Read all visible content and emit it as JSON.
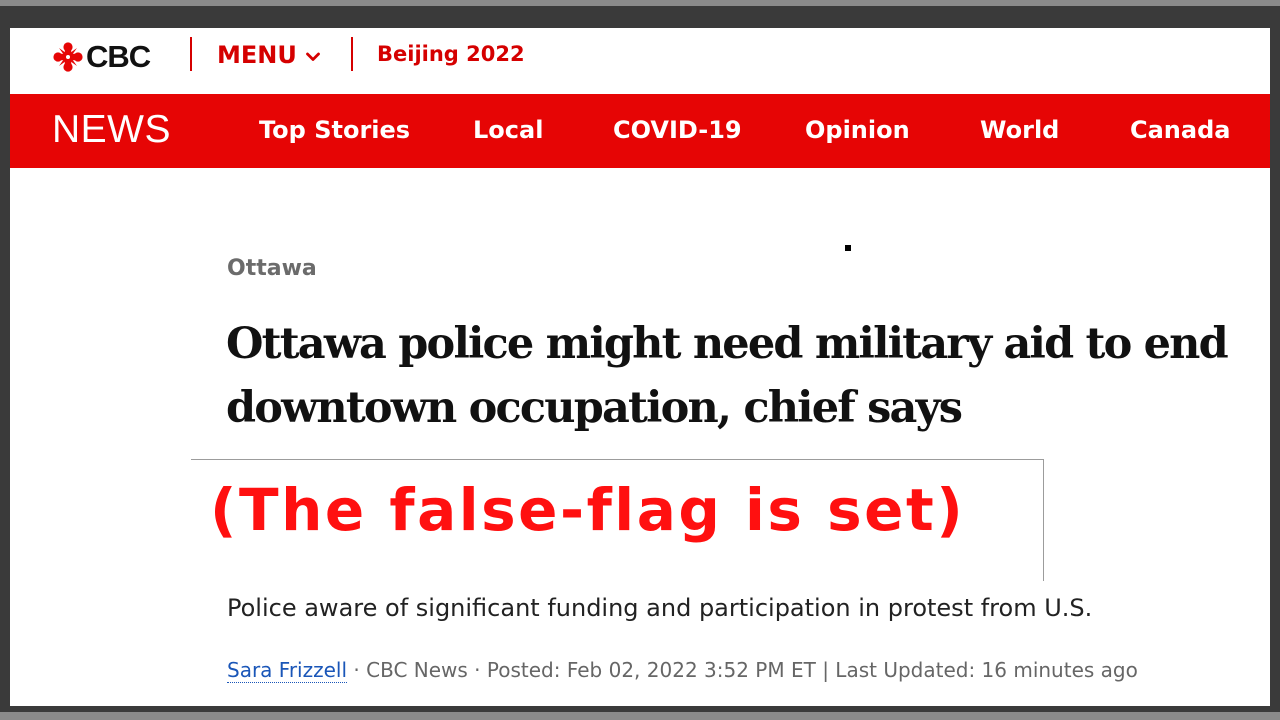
{
  "header": {
    "logo_text": "CBC",
    "menu_label": "MENU",
    "promo_link": "Beijing 2022"
  },
  "nav": {
    "section_title": "NEWS",
    "items": [
      "Top Stories",
      "Local",
      "COVID-19",
      "Opinion",
      "World",
      "Canada"
    ]
  },
  "article": {
    "section": "Ottawa",
    "headline": "Ottawa police might need military aid to end downtown occupation, chief says",
    "overlay_caption": "(The false-flag is set)",
    "deck": "Police aware of significant funding and participation in protest from U.S.",
    "byline": {
      "author": "Sara Frizzell",
      "source": "CBC News",
      "posted": "Posted: Feb 02, 2022 3:52 PM ET",
      "updated": "Last Updated: 16 minutes ago"
    }
  },
  "colors": {
    "brand_red": "#e60505",
    "overlay_red": "#ff1010",
    "link_blue": "#1a56b8"
  },
  "icons": [
    "cbc-gem-icon",
    "chevron-down-icon"
  ]
}
